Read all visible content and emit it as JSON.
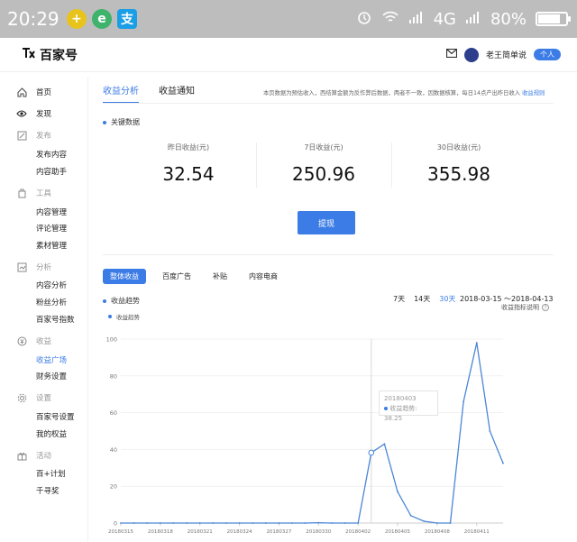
{
  "statusbar": {
    "time": "20:29",
    "network": "4G",
    "battery": "80%",
    "battery_level": 0.8,
    "icons": [
      "alarm-icon",
      "wifi-icon",
      "signal-icon",
      "battery-icon"
    ]
  },
  "header": {
    "logo": "百家号",
    "user_name": "老王简单说",
    "user_tag": "个人"
  },
  "sidebar": {
    "items": [
      {
        "label": "首页",
        "icon": "home-icon",
        "type": "item"
      },
      {
        "label": "发现",
        "icon": "eye-icon",
        "type": "item"
      },
      {
        "label": "发布",
        "icon": "edit-icon",
        "type": "group"
      },
      {
        "label": "发布内容",
        "type": "item"
      },
      {
        "label": "内容助手",
        "type": "item"
      },
      {
        "label": "工具",
        "icon": "tools-icon",
        "type": "group"
      },
      {
        "label": "内容管理",
        "type": "item"
      },
      {
        "label": "评论管理",
        "type": "item"
      },
      {
        "label": "素材管理",
        "type": "item"
      },
      {
        "label": "分析",
        "icon": "analytics-icon",
        "type": "group"
      },
      {
        "label": "内容分析",
        "type": "item"
      },
      {
        "label": "粉丝分析",
        "type": "item"
      },
      {
        "label": "百家号指数",
        "type": "item"
      },
      {
        "label": "收益",
        "icon": "income-icon",
        "type": "group"
      },
      {
        "label": "收益广场",
        "type": "active"
      },
      {
        "label": "财务设置",
        "type": "item"
      },
      {
        "label": "设置",
        "icon": "settings-icon",
        "type": "group"
      },
      {
        "label": "百家号设置",
        "type": "item"
      },
      {
        "label": "我的权益",
        "type": "item"
      },
      {
        "label": "活动",
        "icon": "activity-icon",
        "type": "group"
      },
      {
        "label": "百+计划",
        "type": "item"
      },
      {
        "label": "千寻奖",
        "type": "item"
      }
    ]
  },
  "main": {
    "tabs": [
      {
        "label": "收益分析",
        "active": true
      },
      {
        "label": "收益通知",
        "active": false
      }
    ],
    "notice": "本页数据为预估收入，西结算金额为反作弊后数据，两者不一致，因数据核算，每日14点产出昨日收入",
    "notice_link": "收益规则",
    "key_data_title": "关键数据",
    "metrics": [
      {
        "label": "昨日收益(元)",
        "value": "32.54"
      },
      {
        "label": "7日收益(元)",
        "value": "250.96"
      },
      {
        "label": "30日收益(元)",
        "value": "355.98"
      }
    ],
    "withdraw_label": "提现",
    "subtabs": [
      {
        "label": "整体收益",
        "active": true
      },
      {
        "label": "百度广告",
        "active": false
      },
      {
        "label": "补贴",
        "active": false
      },
      {
        "label": "内容电商",
        "active": false
      }
    ],
    "trend_title": "收益趋势",
    "ranges": [
      {
        "label": "7天",
        "active": false
      },
      {
        "label": "14天",
        "active": false
      },
      {
        "label": "30天",
        "active": true
      }
    ],
    "date_range": "2018-03-15 ～2018-04-13",
    "help_label": "收益指标说明",
    "help_icon": "?",
    "legend_label": "收益趋势",
    "tooltip": {
      "date": "20180403",
      "label": "收益趋势",
      "value": "38.25"
    }
  },
  "chart_data": {
    "type": "line",
    "x": [
      "20180315",
      "20180316",
      "20180317",
      "20180318",
      "20180319",
      "20180320",
      "20180321",
      "20180322",
      "20180323",
      "20180324",
      "20180325",
      "20180326",
      "20180327",
      "20180328",
      "20180329",
      "20180330",
      "20180331",
      "20180401",
      "20180402",
      "20180403",
      "20180404",
      "20180405",
      "20180406",
      "20180407",
      "20180408",
      "20180409",
      "20180410",
      "20180411",
      "20180412",
      "20180413"
    ],
    "x_tick_labels": [
      "20180315",
      "20180318",
      "20180321",
      "20180324",
      "20180327",
      "20180330",
      "20180402",
      "20180405",
      "20180408",
      "20180411"
    ],
    "series": [
      {
        "name": "收益趋势",
        "values": [
          0,
          0,
          0,
          0,
          0,
          0,
          0,
          0,
          0,
          0,
          0,
          0,
          0,
          0,
          0,
          0.2,
          0,
          0,
          0,
          38.25,
          43,
          17,
          4,
          1,
          0,
          0,
          66,
          98,
          50,
          32.54
        ]
      }
    ],
    "ylim": [
      0,
      100
    ],
    "yticks": [
      0,
      20,
      40,
      60,
      80,
      100
    ],
    "grid": true,
    "colors": {
      "line": "#4a86d8",
      "accent": "#3c7ce6"
    }
  }
}
